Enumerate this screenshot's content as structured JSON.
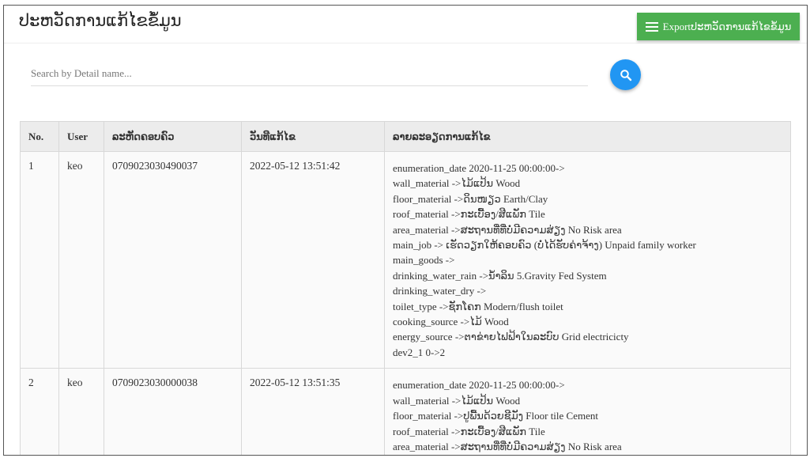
{
  "header": {
    "title": "ປະຫວັດການແກ້ໄຂຂໍ້ມູນ",
    "export_label": "Exportປະຫວັດການແກ້ໄຂຂໍ້ມູນ"
  },
  "search": {
    "placeholder": "Search by Detail name...",
    "value": ""
  },
  "table": {
    "headers": [
      "No.",
      "User",
      "ລະຫັດຄອບຄົວ",
      "ວັນທີແກ້ໄຂ",
      "ລາຍລະອຽດການແກ້ໄຂ"
    ],
    "rows": [
      {
        "no": "1",
        "user": "keo",
        "code": "0709023030490037",
        "date": "2022-05-12 13:51:42",
        "details": [
          "enumeration_date 2020-11-25 00:00:00->",
          "wall_material ->ໄມ້ແປ້ນ Wood",
          "floor_material ->ດິນໜຽວ Earth/Clay",
          "roof_material ->ກະເບື້ອງ/ສີແພັກ Tile",
          "area_material ->ສະຖານທີ່ທີ່ບໍ່ມີຄວາມສ່ຽງ No Risk area",
          "main_job -> ເຮັດວຽກໃຫ້ຄອບຄົວ (ບໍ່ໄດ້ຮັບຄ່າຈ້າງ) Unpaid family worker",
          "main_goods ->",
          "drinking_water_rain ->ນ້ຳລິນ 5.Gravity Fed System",
          "drinking_water_dry ->",
          "toilet_type ->ຊັກໂຄກ Modern/flush toilet",
          "cooking_source ->ໄມ້ Wood",
          "energy_source ->ຕາຂ່າຍໄຟຟ້າໃນລະບົບ Grid electricicty",
          "dev2_1 0->2"
        ]
      },
      {
        "no": "2",
        "user": "keo",
        "code": "0709023030000038",
        "date": "2022-05-12 13:51:35",
        "details": [
          "enumeration_date 2020-11-25 00:00:00->",
          "wall_material ->ໄມ້ແປ້ນ Wood",
          "floor_material ->ປູພື້ນດ້ວຍຊີມັງ Floor tile Cement",
          "roof_material ->ກະເບື້ອງ/ສີແພັກ Tile",
          "area_material ->ສະຖານທີ່ທີ່ບໍ່ມີຄວາມສ່ຽງ No Risk area"
        ]
      }
    ]
  },
  "icons": {
    "menu": "menu-icon",
    "search": "search-icon"
  },
  "colors": {
    "export_button": "#4caf50",
    "search_button": "#2196f3",
    "header_row": "#ececec"
  }
}
